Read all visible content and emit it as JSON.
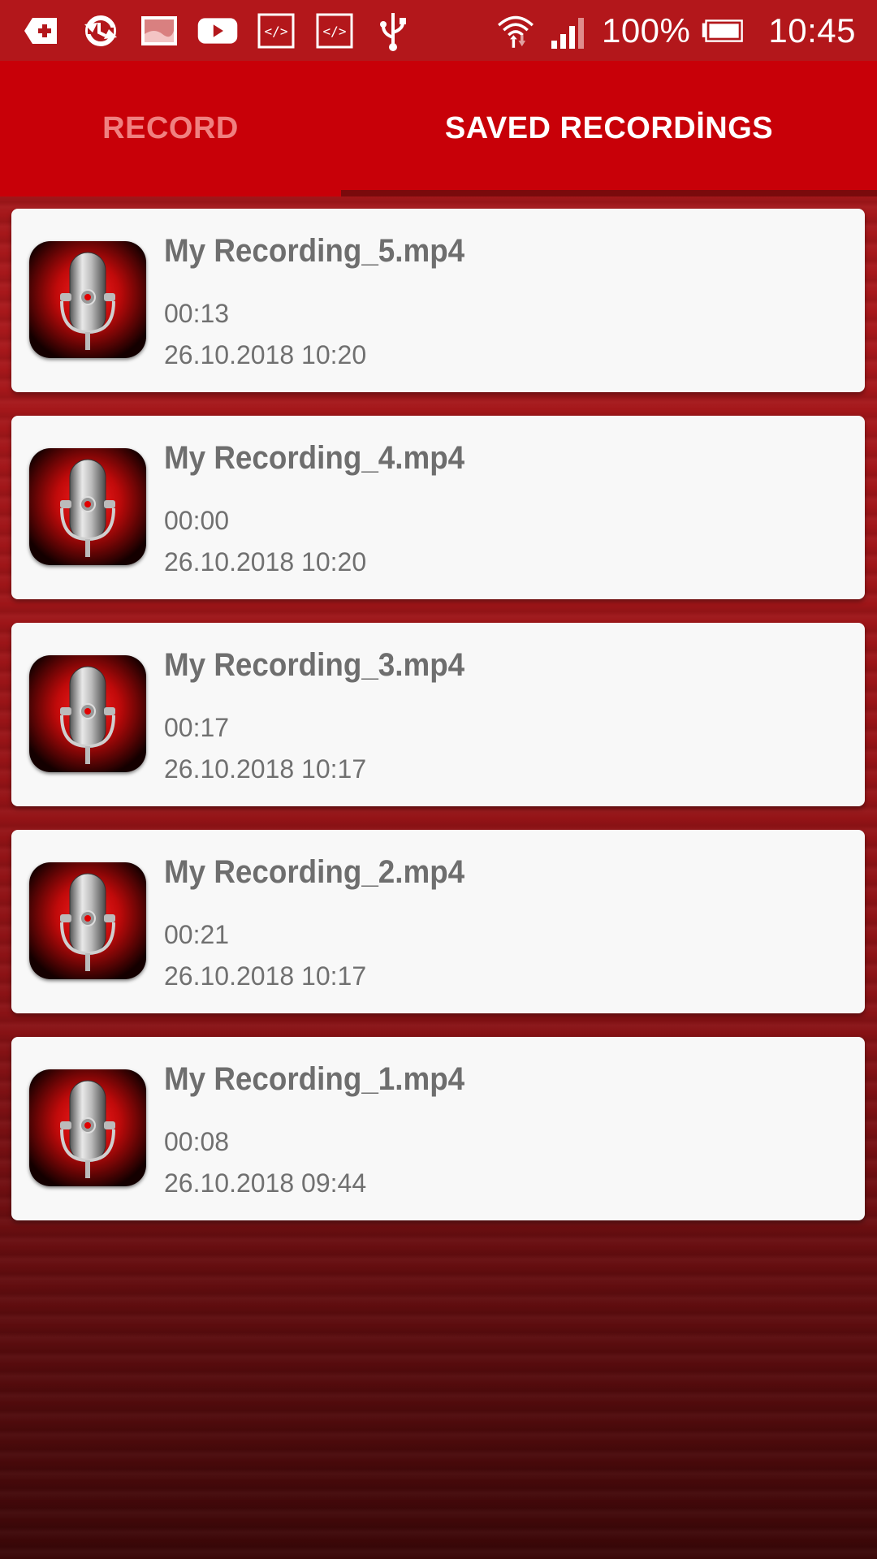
{
  "status_bar": {
    "icons": [
      "add-box-icon",
      "sync-icon",
      "gallery-icon",
      "youtube-icon",
      "code-icon",
      "code-icon",
      "usb-icon",
      "wifi-icon",
      "signal-icon",
      "battery-icon"
    ],
    "battery_percent": "100%",
    "time": "10:45"
  },
  "tabs": {
    "record": "RECORD",
    "saved": "SAVED RECORDİNGS",
    "selected": "saved"
  },
  "recordings": [
    {
      "title": "My Recording_5.mp4",
      "duration": "00:13",
      "date": "26.10.2018 10:20"
    },
    {
      "title": "My Recording_4.mp4",
      "duration": "00:00",
      "date": "26.10.2018 10:20"
    },
    {
      "title": "My Recording_3.mp4",
      "duration": "00:17",
      "date": "26.10.2018 10:17"
    },
    {
      "title": "My Recording_2.mp4",
      "duration": "00:21",
      "date": "26.10.2018 10:17"
    },
    {
      "title": "My Recording_1.mp4",
      "duration": "00:08",
      "date": "26.10.2018 09:44"
    }
  ],
  "colors": {
    "status_bar": "#b3171b",
    "tab_bar": "#c80008",
    "tab_inactive": "#f08080",
    "tab_indicator": "#7a0a0c",
    "card_bg": "#f8f8f8",
    "card_text": "#6e6e6e"
  }
}
